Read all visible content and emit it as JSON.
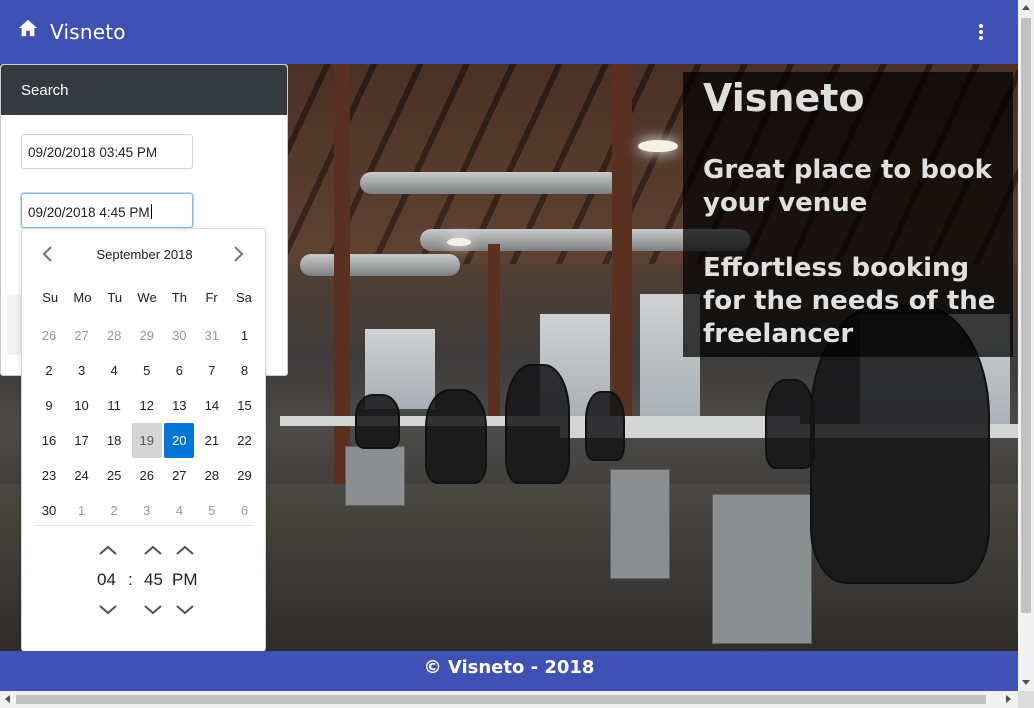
{
  "appbar": {
    "title": "Visneto",
    "home_icon": "home-icon",
    "menu_icon": "more-vert-icon",
    "color": "#3f51b5"
  },
  "hero": {
    "title": "Visneto",
    "line1": "Great place to book your venue",
    "line2": "Effortless booking for the needs of the freelancer"
  },
  "search": {
    "header": "Search",
    "start_value": "09/20/2018 03:45 PM",
    "end_value": "09/20/2018 4:45 PM"
  },
  "datepicker": {
    "month_label": "September 2018",
    "weekdays": [
      "Su",
      "Mo",
      "Tu",
      "We",
      "Th",
      "Fr",
      "Sa"
    ],
    "weeks": [
      [
        "26",
        "27",
        "28",
        "29",
        "30",
        "31",
        "1"
      ],
      [
        "2",
        "3",
        "4",
        "5",
        "6",
        "7",
        "8"
      ],
      [
        "9",
        "10",
        "11",
        "12",
        "13",
        "14",
        "15"
      ],
      [
        "16",
        "17",
        "18",
        "19",
        "20",
        "21",
        "22"
      ],
      [
        "23",
        "24",
        "25",
        "26",
        "27",
        "28",
        "29"
      ],
      [
        "30",
        "1",
        "2",
        "3",
        "4",
        "5",
        "6"
      ]
    ],
    "today": "19",
    "selected": "20",
    "time": {
      "hour": "04",
      "separator": ":",
      "minute": "45",
      "period": "PM"
    },
    "selected_color": "#0275d8"
  },
  "footer": {
    "text": "© Visneto - 2018"
  }
}
